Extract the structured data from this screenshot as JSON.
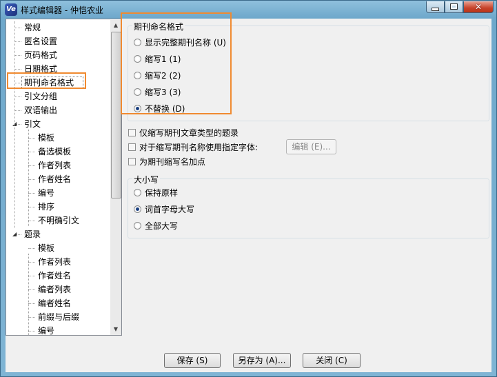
{
  "window": {
    "title": "样式编辑器 - 仲恺农业",
    "app_icon": "Ve",
    "controls": {
      "minimize": "minimize-icon",
      "maximize": "maximize-icon",
      "close": "close-icon",
      "close_glyph": "✕"
    }
  },
  "tree": {
    "items": [
      {
        "label": "常规",
        "level": 0
      },
      {
        "label": "匿名设置",
        "level": 0
      },
      {
        "label": "页码格式",
        "level": 0
      },
      {
        "label": "日期格式",
        "level": 0
      },
      {
        "label": "期刊命名格式",
        "level": 0,
        "selected": true
      },
      {
        "label": "引文分组",
        "level": 0
      },
      {
        "label": "双语输出",
        "level": 0
      },
      {
        "label": "引文",
        "level": 0,
        "expanded": true
      },
      {
        "label": "模板",
        "level": 1
      },
      {
        "label": "备选模板",
        "level": 1
      },
      {
        "label": "作者列表",
        "level": 1
      },
      {
        "label": "作者姓名",
        "level": 1
      },
      {
        "label": "编号",
        "level": 1
      },
      {
        "label": "排序",
        "level": 1
      },
      {
        "label": "不明确引文",
        "level": 1
      },
      {
        "label": "题录",
        "level": 0,
        "expanded": true
      },
      {
        "label": "模板",
        "level": 1
      },
      {
        "label": "作者列表",
        "level": 1
      },
      {
        "label": "作者姓名",
        "level": 1
      },
      {
        "label": "编者列表",
        "level": 1
      },
      {
        "label": "编者姓名",
        "level": 1
      },
      {
        "label": "前缀与后缀",
        "level": 1
      },
      {
        "label": "编号",
        "level": 1
      }
    ],
    "expand_glyph": "◢"
  },
  "journal_naming": {
    "title": "期刊命名格式",
    "options": [
      {
        "label": "显示完整期刊名称 (U)",
        "checked": false
      },
      {
        "label": "缩写1 (1)",
        "checked": false
      },
      {
        "label": "缩写2 (2)",
        "checked": false
      },
      {
        "label": "缩写3 (3)",
        "checked": false
      },
      {
        "label": "不替换 (D)",
        "checked": true
      }
    ]
  },
  "checkboxes": [
    {
      "label": "仅缩写期刊文章类型的题录",
      "checked": false
    },
    {
      "label": "对于缩写期刊名称使用指定字体:",
      "checked": false
    },
    {
      "label": "为期刊缩写名加点",
      "checked": false
    }
  ],
  "edit_button": "编辑 (E)...",
  "case": {
    "title": "大小写",
    "options": [
      {
        "label": "保持原样",
        "checked": false
      },
      {
        "label": "词首字母大写",
        "checked": true
      },
      {
        "label": "全部大写",
        "checked": false
      }
    ]
  },
  "footer": {
    "save": "保存 (S)",
    "save_as": "另存为 (A)...",
    "close": "关闭 (C)"
  },
  "colors": {
    "highlight": "#f08a30",
    "radio_dot": "#1a3f80"
  }
}
